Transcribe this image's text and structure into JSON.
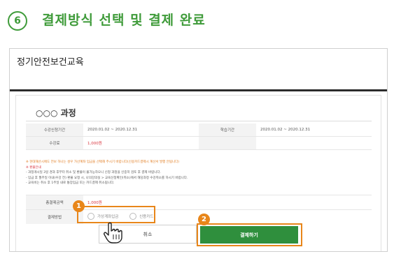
{
  "step": {
    "number": "6",
    "title": "결제방식 선택 및 결제 완료"
  },
  "frame": {
    "title": "정기안전보건교육"
  },
  "course": {
    "title": "○○○ 과정",
    "rows": [
      {
        "label": "수강신청기간",
        "value": "2020.01.02 ~ 2020.12.31",
        "label2": "학습기간",
        "value2": "2020.01.02 ~ 2020.12.31"
      },
      {
        "label": "수강료",
        "value": "1,000원",
        "label2": "",
        "value2": ""
      }
    ]
  },
  "notes": {
    "warning": "※ 현대해산시에도 전보 하나는 성우 가산계좌 입금을 선택해 주시기 바랍니다(신용카드결제시 계산서 발행 안됩니다)",
    "heading": "※ 환불안내",
    "lines": [
      "- 과정개시일 3일 경과 후부터 취소 및 환불이 불가능하오니 신청 과정을 신중히 검토 후 결제 바랍니다.",
      "- 입금 후 월주일 이내(수강 전) 환불 요청 시, 나의강의실 > 교육신청확인(취소)에서 해당과정 수강취소를 하시기 바랍니다.",
      "- 교육비는 취소 후 1주일 내로 통장입금 또는 카드결제 취소됩니다."
    ]
  },
  "payment": {
    "total_label": "총결제금액",
    "total_value": "1,000원",
    "method_label": "결제방법",
    "options": [
      "가상계좌입금",
      "신용카드"
    ]
  },
  "buttons": {
    "cancel": "취소",
    "pay": "결제하기"
  },
  "badges": {
    "one": "1",
    "two": "2"
  },
  "colors": {
    "accent_green": "#3f9b3a",
    "button_green": "#2f8f3d",
    "highlight_orange": "#e8861a"
  },
  "icons": [
    "hand-pointer-icon",
    "radio-icon"
  ]
}
